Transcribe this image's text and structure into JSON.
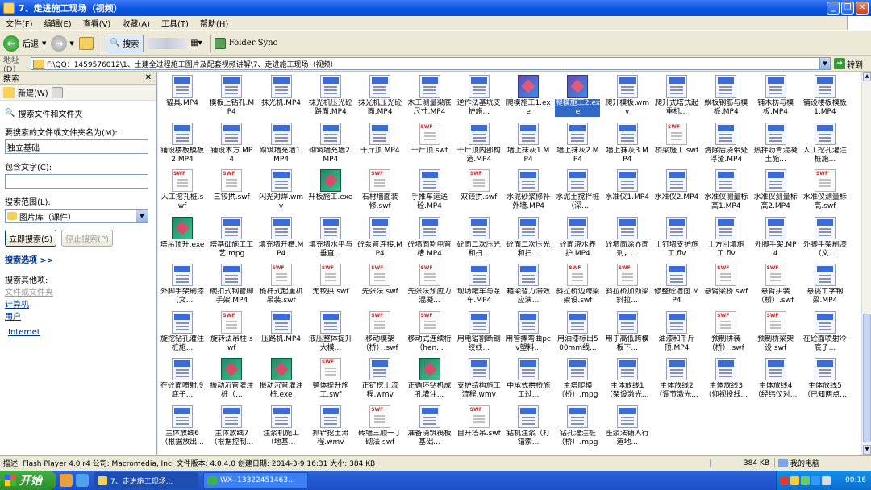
{
  "window": {
    "title": "7、走进施工现场（视频）"
  },
  "menu": [
    "文件(F)",
    "编辑(E)",
    "查看(V)",
    "收藏(A)",
    "工具(T)",
    "帮助(H)"
  ],
  "toolbar": {
    "back": "后退",
    "search": "搜索",
    "folder_sync": "Folder Sync"
  },
  "address": {
    "label": "地址(D)",
    "path": "F:\\QQ：1459576012\\1、土建全过程施工图片及配套视频讲解\\7、走进施工现场（视频）",
    "go": "转到"
  },
  "search_pane": {
    "title": "搜索",
    "new": "新建(W)",
    "files_folders": "搜索文件和文件夹",
    "name_label": "要搜索的文件或文件夹名为(M):",
    "name_value": "独立基础",
    "contains_label": "包含文字(C):",
    "contains_value": "",
    "scope_label": "搜索范围(L):",
    "scope_value": "图片库（课件）",
    "search_now": "立即搜索(S)",
    "stop": "停止搜索(P)",
    "options": "搜索选项 >>",
    "other_label": "搜索其他项:",
    "other_items": [
      "文件或文件夹",
      "计算机",
      "用户"
    ],
    "internet": "Internet"
  },
  "files": [
    {
      "n": "锚具.MP4",
      "t": "video"
    },
    {
      "n": "模板上钻孔.MP4",
      "t": "video"
    },
    {
      "n": "抹光机.MP4",
      "t": "video"
    },
    {
      "n": "抹光机压光砼路面.MP4",
      "t": "video"
    },
    {
      "n": "抹光机压光砼面.MP4",
      "t": "video"
    },
    {
      "n": "木工测量梁底尺寸.MP4",
      "t": "video"
    },
    {
      "n": "逆作法基坑支护施...",
      "t": "video"
    },
    {
      "n": "爬模施工1.exe",
      "t": "exeb"
    },
    {
      "n": "爬模施工2.exe",
      "t": "exeb",
      "sel": true
    },
    {
      "n": "爬升模板.wmv",
      "t": "video"
    },
    {
      "n": "爬升式塔式起重机...",
      "t": "video"
    },
    {
      "n": "飘板钢筋与模板.MP4",
      "t": "video"
    },
    {
      "n": "铺木枋与模板.MP4",
      "t": "video"
    },
    {
      "n": "铺设楼板模板1.MP4",
      "t": "video"
    },
    {
      "n": "铺设楼板模板2.MP4",
      "t": "video"
    },
    {
      "n": "铺设木方.MP4",
      "t": "video"
    },
    {
      "n": "砌筑墙充墙1.MP4",
      "t": "video"
    },
    {
      "n": "砌筑墙充墙2.MP4",
      "t": "video"
    },
    {
      "n": "千斤顶.MP4",
      "t": "video"
    },
    {
      "n": "千斤顶.swf",
      "t": "swf"
    },
    {
      "n": "千斤顶内部构造.MP4",
      "t": "video"
    },
    {
      "n": "墙上抹灰1.MP4",
      "t": "video"
    },
    {
      "n": "墙上抹灰2.MP4",
      "t": "video"
    },
    {
      "n": "墙上抹灰3.MP4",
      "t": "video"
    },
    {
      "n": "桥梁施工.swf",
      "t": "swf"
    },
    {
      "n": "清除后浇带处浮渣.MP4",
      "t": "video"
    },
    {
      "n": "热拌沥青混凝土施...",
      "t": "video"
    },
    {
      "n": "人工挖孔灌注桩施...",
      "t": "video"
    },
    {
      "n": "人工挖孔桩.swf",
      "t": "swf"
    },
    {
      "n": "三铰拱.swf",
      "t": "swf"
    },
    {
      "n": "闪光对焊.wmv",
      "t": "video"
    },
    {
      "n": "升板施工.exe",
      "t": "exe"
    },
    {
      "n": "石材墙面装修.swf",
      "t": "swf"
    },
    {
      "n": "手推车运送砼.MP4",
      "t": "video"
    },
    {
      "n": "双铰拱.swf",
      "t": "swf"
    },
    {
      "n": "水泥砂浆修补外墙.MP4",
      "t": "video"
    },
    {
      "n": "水泥土搅拌桩（深...",
      "t": "video"
    },
    {
      "n": "水准仪1.MP4",
      "t": "video"
    },
    {
      "n": "水准仪2.MP4",
      "t": "video"
    },
    {
      "n": "水准仪测量标高1.MP4",
      "t": "video"
    },
    {
      "n": "水准仪测量标高2.MP4",
      "t": "video"
    },
    {
      "n": "水准仪测量标高.swf",
      "t": "swf"
    },
    {
      "n": "塔吊顶升.exe",
      "t": "exe"
    },
    {
      "n": "塔基础施工工艺.mpg",
      "t": "video"
    },
    {
      "n": "填充墙开槽.MP4",
      "t": "video"
    },
    {
      "n": "填充墙水平与垂直...",
      "t": "video"
    },
    {
      "n": "砼泵管连接.MP4",
      "t": "video"
    },
    {
      "n": "砼墙面割电管槽.MP4",
      "t": "video"
    },
    {
      "n": "砼面二次压光和扫...",
      "t": "video"
    },
    {
      "n": "砼面二次压光和扫...",
      "t": "video"
    },
    {
      "n": "砼面浇水养护.MP4",
      "t": "video"
    },
    {
      "n": "砼墙面涂界面剂，...",
      "t": "video"
    },
    {
      "n": "土钉墙支护施工.flv",
      "t": "video"
    },
    {
      "n": "土方回填施工.flv",
      "t": "video"
    },
    {
      "n": "外脚手架.MP4",
      "t": "video"
    },
    {
      "n": "外脚手架刷漆（文...",
      "t": "video"
    },
    {
      "n": "外脚手架刷漆（文...",
      "t": "video"
    },
    {
      "n": "碗扣式钢管脚手架.MP4",
      "t": "video"
    },
    {
      "n": "桅杆式起重机吊装.swf",
      "t": "swf"
    },
    {
      "n": "无铰拱.swf",
      "t": "swf"
    },
    {
      "n": "先张法.swf",
      "t": "swf"
    },
    {
      "n": "先张法预应力混凝...",
      "t": "swf"
    },
    {
      "n": "现场罐车与泵车.MP4",
      "t": "video"
    },
    {
      "n": "箱梁智力滞效应演...",
      "t": "video"
    },
    {
      "n": "斜拉桥边跨梁架设.swf",
      "t": "swf"
    },
    {
      "n": "斜拉桥加劲梁斜拉...",
      "t": "swf"
    },
    {
      "n": "修整砼墙面.MP4",
      "t": "video"
    },
    {
      "n": "悬臂梁桥.swf",
      "t": "swf"
    },
    {
      "n": "悬臂拼装（桥）.swf",
      "t": "swf"
    },
    {
      "n": "悬挑工字钢梁.MP4",
      "t": "video"
    },
    {
      "n": "旋挖钻孔灌注桩施...",
      "t": "video"
    },
    {
      "n": "旋转法吊柱.swf",
      "t": "swf"
    },
    {
      "n": "压路机.MP4",
      "t": "video"
    },
    {
      "n": "液压整体提升大模...",
      "t": "video"
    },
    {
      "n": "移动模架（桥）.swf",
      "t": "swf"
    },
    {
      "n": "移动式连续桁（hen...",
      "t": "swf"
    },
    {
      "n": "用电锯割断钢绞线...",
      "t": "video"
    },
    {
      "n": "用管捧弯曲pcv塑料...",
      "t": "video"
    },
    {
      "n": "用油漆标出500mm线...",
      "t": "video"
    },
    {
      "n": "用于高低跨模板下...",
      "t": "video"
    },
    {
      "n": "油漆和千斤顶.MP4",
      "t": "video"
    },
    {
      "n": "预制拼装（桥）.swf",
      "t": "swf"
    },
    {
      "n": "预制桥梁架设.swf",
      "t": "swf"
    },
    {
      "n": "在砼面喷射冷底子...",
      "t": "video"
    },
    {
      "n": "在砼面喷射冷底子...",
      "t": "video"
    },
    {
      "n": "振动沉管灌注桩（...",
      "t": "exe"
    },
    {
      "n": "振动沉管灌注桩.exe",
      "t": "exe"
    },
    {
      "n": "整体提升施工.swf",
      "t": "swf"
    },
    {
      "n": "正铲挖土流程.wmv",
      "t": "video"
    },
    {
      "n": "正循环钻机成孔灌注...",
      "t": "exe"
    },
    {
      "n": "支护结构施工流程.wmv",
      "t": "video"
    },
    {
      "n": "中承式拱桥施工过...",
      "t": "video"
    },
    {
      "n": "主塔爬模（桥）.mpg",
      "t": "video"
    },
    {
      "n": "主体放线1（架设激光...",
      "t": "video"
    },
    {
      "n": "主体放线2（调节激光...",
      "t": "video"
    },
    {
      "n": "主体放线3（仰视投线...",
      "t": "video"
    },
    {
      "n": "主体放线4（经纬仪对...",
      "t": "video"
    },
    {
      "n": "主体放线5（已知两点...",
      "t": "video"
    },
    {
      "n": "主体放线6（根据放出...",
      "t": "video"
    },
    {
      "n": "主体放线7（根据控制...",
      "t": "video"
    },
    {
      "n": "注浆机施工（地基...",
      "t": "video"
    },
    {
      "n": "抓铲挖土流程.wmv",
      "t": "video"
    },
    {
      "n": "砖墙三顺一丁砌法.swf",
      "t": "swf"
    },
    {
      "n": "准备浇筑筏板基础...",
      "t": "video"
    },
    {
      "n": "自升塔吊.swf",
      "t": "swf"
    },
    {
      "n": "钻机注浆（打锚索...",
      "t": "video"
    },
    {
      "n": "钻孔灌注桩（桥）.mpg",
      "t": "video"
    },
    {
      "n": "座浆法铺人行道地...",
      "t": "video"
    }
  ],
  "status": {
    "desc": "描述: Flash Player 4.0 r4 公司: Macromedia, Inc. 文件版本: 4.0.4.0 创建日期: 2014-3-9 16:31 大小: 384 KB",
    "size": "384 KB",
    "zone": "我的电脑"
  },
  "taskbar": {
    "start": "开始",
    "tasks": [
      "7、走进施工现场...",
      "WX--13322451463..."
    ],
    "clock": "00:16"
  }
}
